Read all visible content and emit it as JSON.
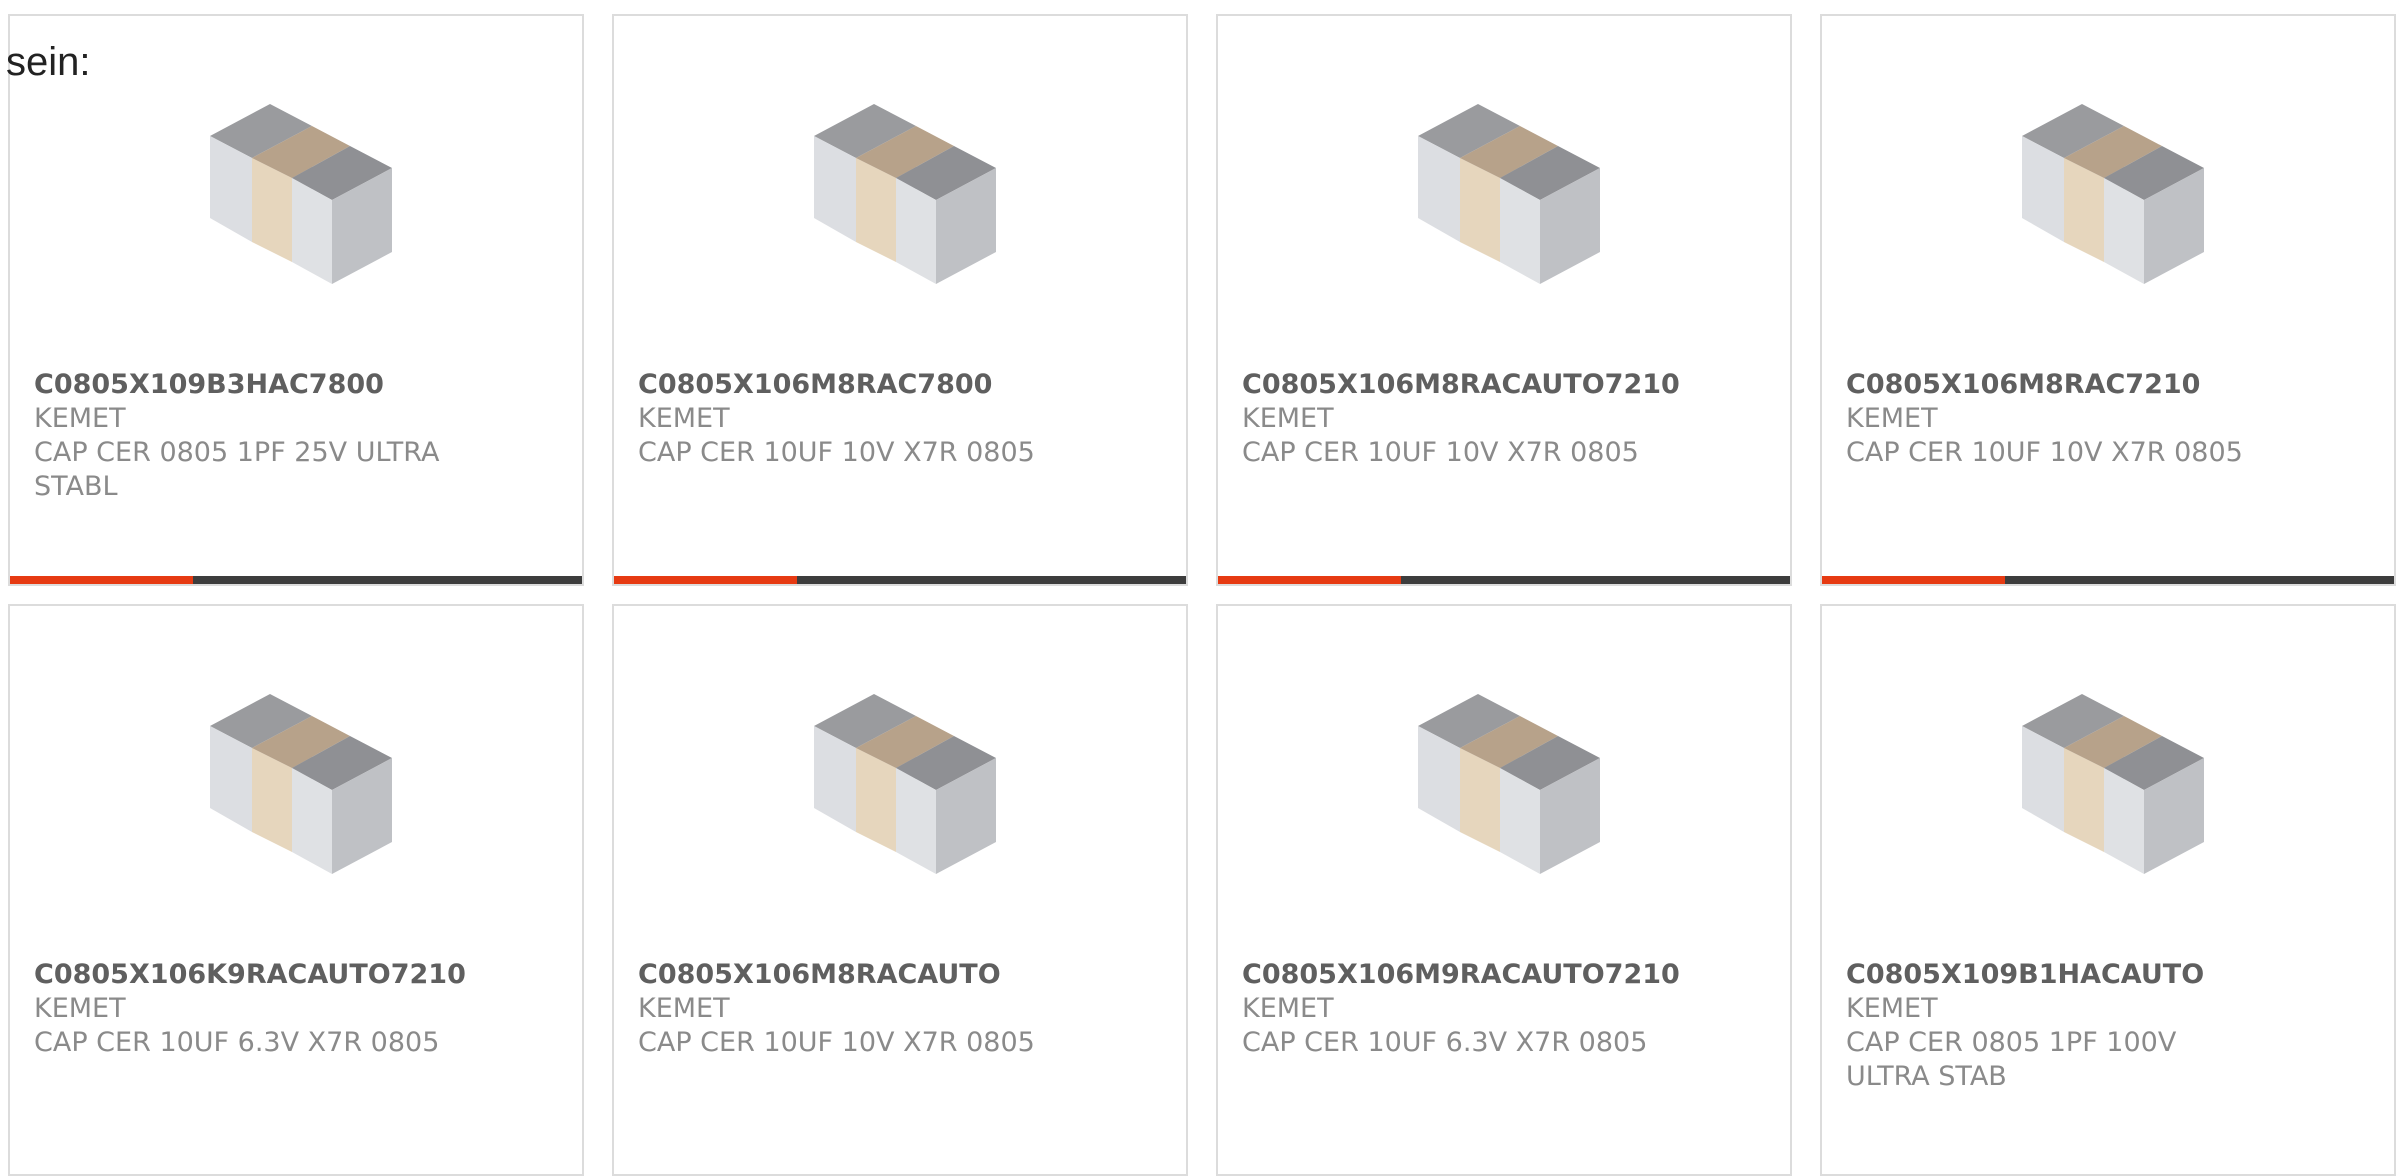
{
  "intro_text": "sein:",
  "accent_color": "#e63a12",
  "products": [
    {
      "part_number": "C0805X109B3HAC7800",
      "manufacturer": "KEMET",
      "description": "CAP CER 0805 1PF 25V ULTRA STABL",
      "image_icon": "ceramic-capacitor-chip",
      "progress": 0.32
    },
    {
      "part_number": "C0805X106M8RAC7800",
      "manufacturer": "KEMET",
      "description": "CAP CER 10UF 10V X7R 0805",
      "image_icon": "ceramic-capacitor-chip",
      "progress": 0.32
    },
    {
      "part_number": "C0805X106M8RACAUTO7210",
      "manufacturer": "KEMET",
      "description": "CAP CER 10UF 10V X7R 0805",
      "image_icon": "ceramic-capacitor-chip",
      "progress": 0.32
    },
    {
      "part_number": "C0805X106M8RAC7210",
      "manufacturer": "KEMET",
      "description": "CAP CER 10UF 10V X7R 0805",
      "image_icon": "ceramic-capacitor-chip",
      "progress": 0.32
    },
    {
      "part_number": "C0805X106K9RACAUTO7210",
      "manufacturer": "KEMET",
      "description": "CAP CER 10UF 6.3V X7R 0805",
      "image_icon": "ceramic-capacitor-chip"
    },
    {
      "part_number": "C0805X106M8RACAUTO",
      "manufacturer": "KEMET",
      "description": "CAP CER 10UF 10V X7R 0805",
      "image_icon": "ceramic-capacitor-chip"
    },
    {
      "part_number": "C0805X106M9RACAUTO7210",
      "manufacturer": "KEMET",
      "description": "CAP CER 10UF 6.3V X7R 0805",
      "image_icon": "ceramic-capacitor-chip"
    },
    {
      "part_number": "C0805X109B1HACAUTO",
      "manufacturer": "KEMET",
      "description": "CAP CER 0805 1PF 100V ULTRA STAB",
      "image_icon": "ceramic-capacitor-chip"
    }
  ]
}
